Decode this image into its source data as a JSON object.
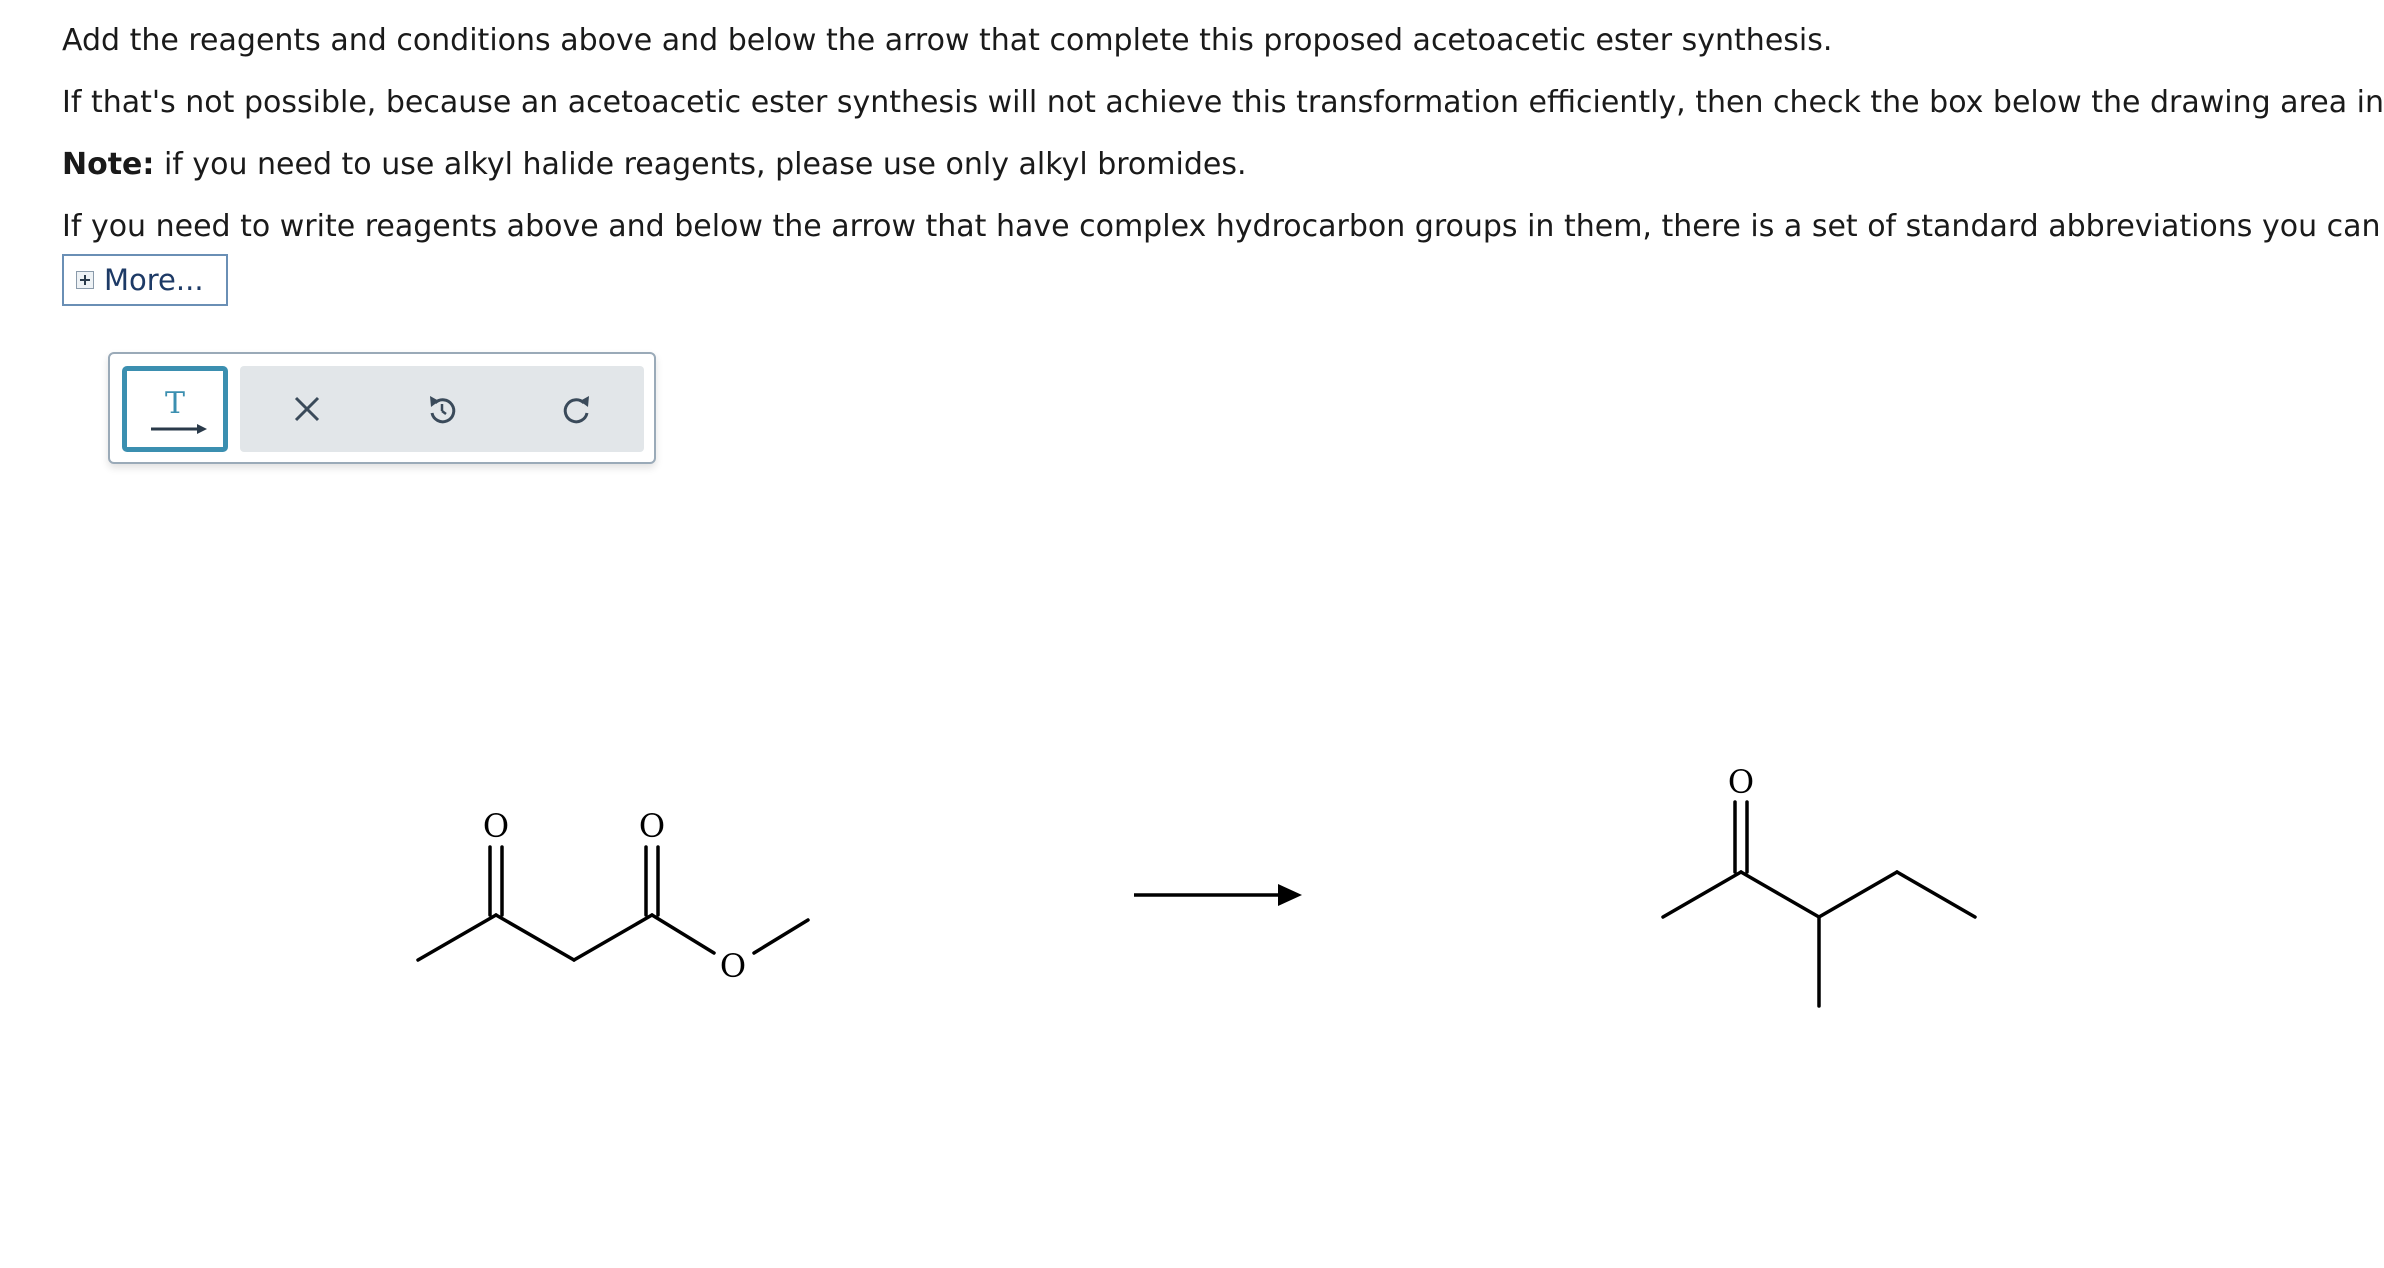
{
  "instructions": {
    "line1": "Add the reagents and conditions above and below the arrow that complete this proposed acetoacetic ester synthesis.",
    "line2": "If that's not possible, because an acetoacetic ester synthesis will not achieve this transformation efficiently, then check the box below the drawing area instead.",
    "note_label": "Note:",
    "note_text": " if you need to use alkyl halide reagents, please use only alkyl bromides.",
    "line4": "If you need to write reagents above and below the arrow that have complex hydrocarbon groups in them, there is a set of standard abbreviations you can use."
  },
  "more_button": {
    "label": "More..."
  },
  "toolbar": {
    "text_tool_letter": "T",
    "icons": [
      "text-arrow-icon",
      "close-icon",
      "undo-icon",
      "redo-icon"
    ]
  },
  "reactant": {
    "atom_labels": [
      "O",
      "O",
      "O"
    ]
  },
  "product": {
    "atom_labels": [
      "O"
    ]
  },
  "colors": {
    "tool_active_border": "#3b8fb0",
    "toolbar_group_bg": "#e2e6e9",
    "link_blue": "#1d3a66"
  }
}
